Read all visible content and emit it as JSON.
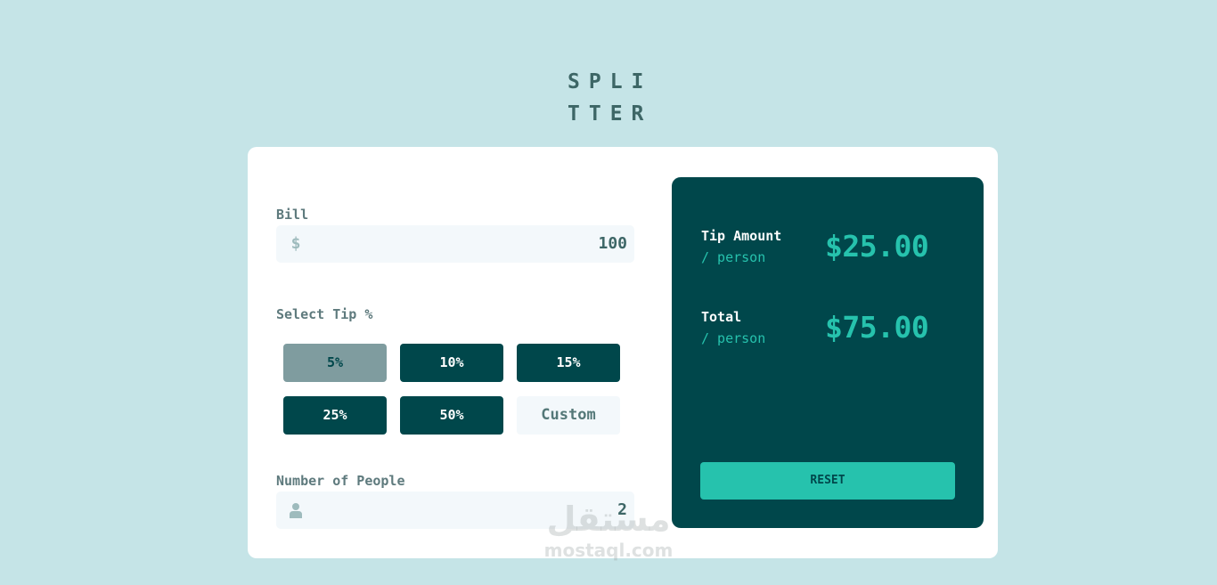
{
  "logo": {
    "line1": "SPLI",
    "line2": "TTER"
  },
  "bill": {
    "label": "Bill",
    "icon": "dollar-icon",
    "icon_glyph": "$",
    "value": "100"
  },
  "tip": {
    "label": "Select Tip %",
    "options": [
      "5%",
      "10%",
      "15%",
      "25%",
      "50%"
    ],
    "selected": "5%",
    "custom_placeholder": "Custom"
  },
  "people": {
    "label": "Number of People",
    "icon": "person-icon",
    "value": "2"
  },
  "results": {
    "tip_amount_label": "Tip Amount",
    "tip_amount_sub": "/ person",
    "tip_amount_value": "$25.00",
    "total_label": "Total",
    "total_sub": "/ person",
    "total_value": "$75.00",
    "reset_label": "RESET"
  },
  "watermark": {
    "arabic": "مستقل",
    "latin": "mostaql.com"
  },
  "colors": {
    "background": "#c5e4e7",
    "dark_cyan": "#00474b",
    "strong_cyan": "#26c2ad",
    "selected_tip": "#7f9c9f",
    "input_bg": "#f3f8fb"
  }
}
